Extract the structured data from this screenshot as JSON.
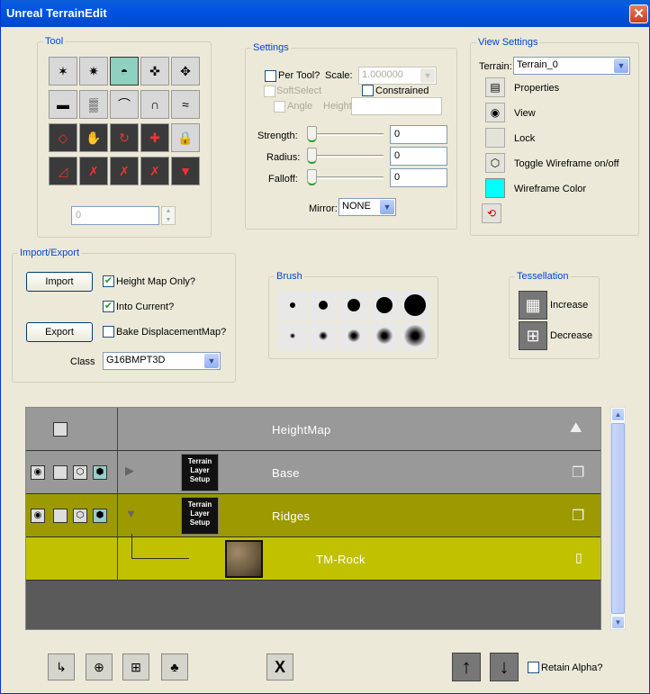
{
  "window": {
    "title": "Unreal TerrainEdit",
    "close": "✕"
  },
  "tool": {
    "legend": "Tool",
    "value": "0",
    "icons": [
      [
        "paint-vertex",
        "paint-flatten",
        "paint-select",
        "smooth-select",
        "move-select"
      ],
      [
        "flatten",
        "noise",
        "smooth",
        "average",
        "erode"
      ],
      [
        "visibility",
        "paint-hand",
        "rotate",
        "tangent",
        "lock"
      ],
      [
        "edge-turn",
        "delete-a",
        "delete-b",
        "delete-c",
        "arrow-red"
      ]
    ]
  },
  "settings": {
    "legend": "Settings",
    "per_tool": "Per Tool?",
    "scale_label": "Scale:",
    "scale_value": "1.000000",
    "softselect": "SoftSelect",
    "constrained": "Constrained",
    "angle": "Angle",
    "height": "Height",
    "strength_label": "Strength:",
    "strength_value": "0",
    "radius_label": "Radius:",
    "radius_value": "0",
    "falloff_label": "Falloff:",
    "falloff_value": "0",
    "mirror_label": "Mirror:",
    "mirror_value": "NONE"
  },
  "view_settings": {
    "legend": "View Settings",
    "terrain_label": "Terrain:",
    "terrain_value": "Terrain_0",
    "properties": "Properties",
    "view": "View",
    "lock": "Lock",
    "toggle_wireframe": "Toggle Wireframe on/off",
    "wireframe_color": "Wireframe Color",
    "wireframe_hex": "#00ffff"
  },
  "import_export": {
    "legend": "Import/Export",
    "import": "Import",
    "export": "Export",
    "height_map_only": "Height Map Only?",
    "into_current": "Into Current?",
    "bake": "Bake DisplacementMap?",
    "class_label": "Class",
    "class_value": "G16BMPT3D"
  },
  "brush": {
    "legend": "Brush"
  },
  "tessellation": {
    "legend": "Tessellation",
    "increase": "Increase",
    "decrease": "Decrease"
  },
  "layers": {
    "rows": [
      {
        "name": "HeightMap"
      },
      {
        "name": "Base",
        "badge": "Terrain Layer Setup"
      },
      {
        "name": "Ridges",
        "badge": "Terrain Layer Setup"
      },
      {
        "name": "TM-Rock"
      }
    ]
  },
  "bottom": {
    "retain_alpha": "Retain Alpha?",
    "delete_glyph": "X",
    "up": "↑",
    "down": "↓"
  },
  "colors": {
    "ridges": "#9c9a00",
    "tmrock": "#c1c100",
    "list_gray": "#5a5a5a"
  }
}
